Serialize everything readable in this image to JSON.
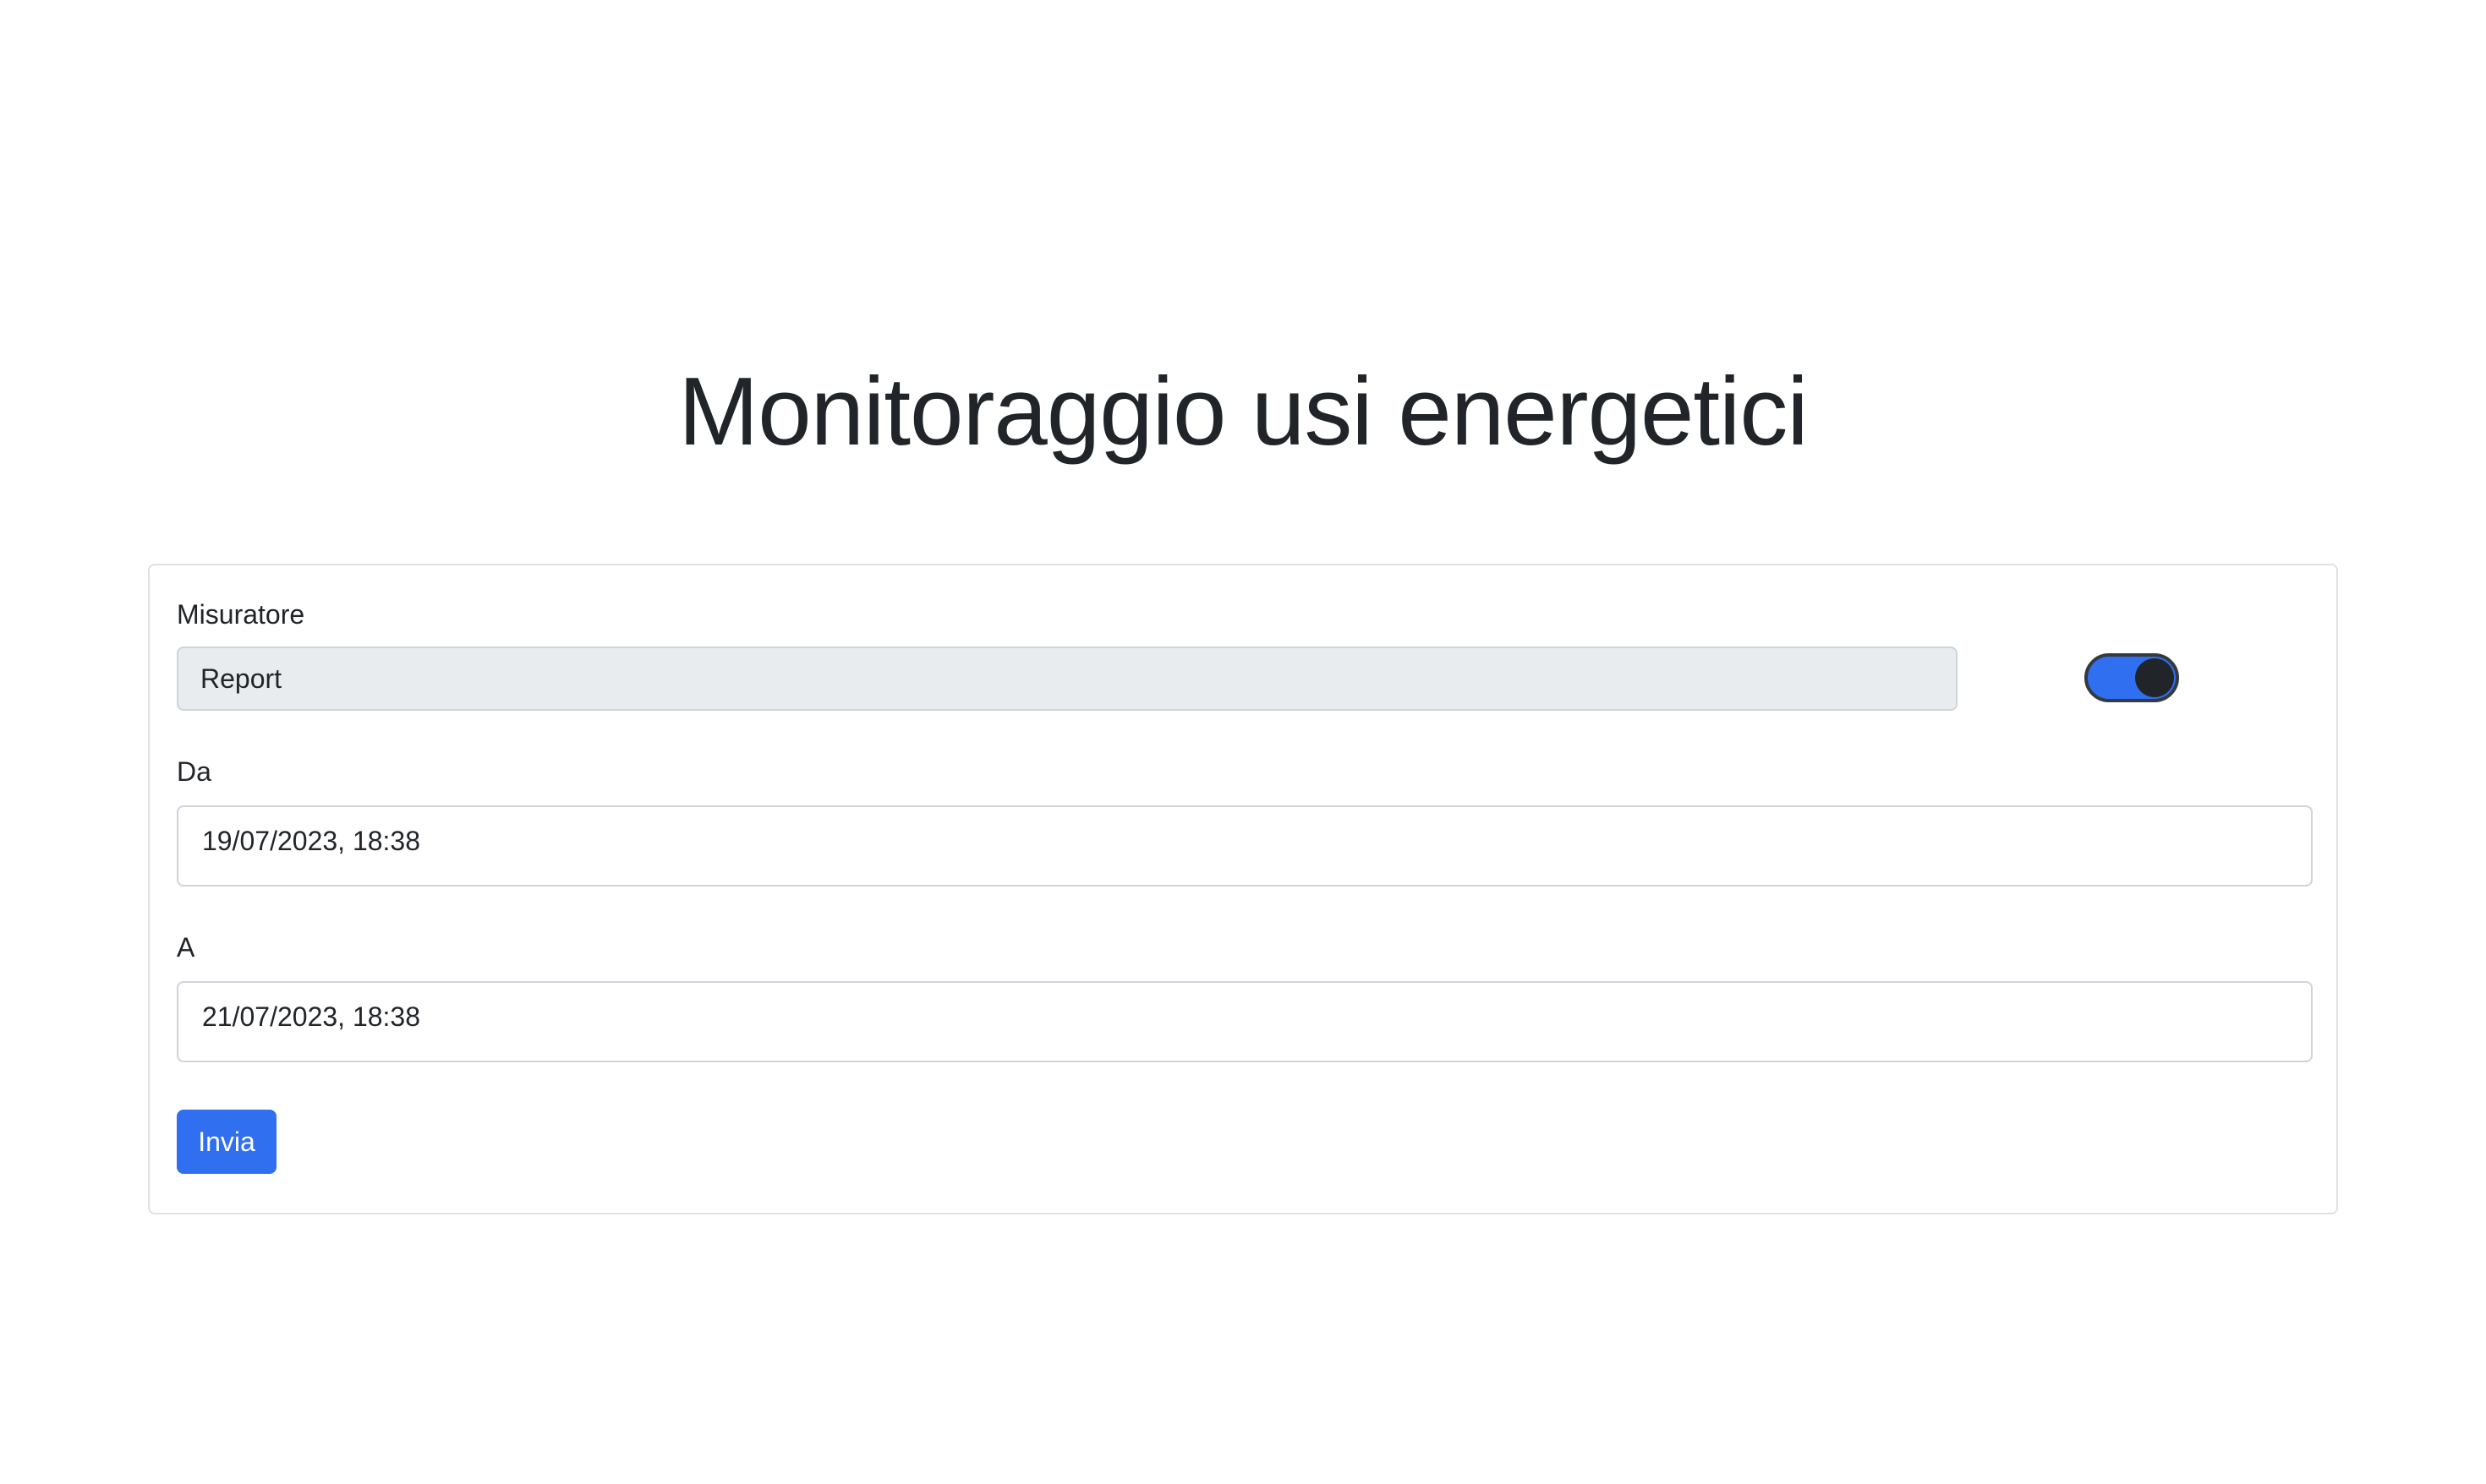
{
  "page": {
    "title": "Monitoraggio usi energetici"
  },
  "form": {
    "misuratore": {
      "label": "Misuratore",
      "selected_value": "Report"
    },
    "toggle": {
      "checked": true,
      "color_on": "#2f6ff0"
    },
    "da": {
      "label": "Da",
      "value": "19/07/2023, 18:38"
    },
    "a": {
      "label": "A",
      "value": "21/07/2023, 18:38"
    },
    "submit": {
      "label": "Invia",
      "color": "#2f6ff0"
    }
  }
}
